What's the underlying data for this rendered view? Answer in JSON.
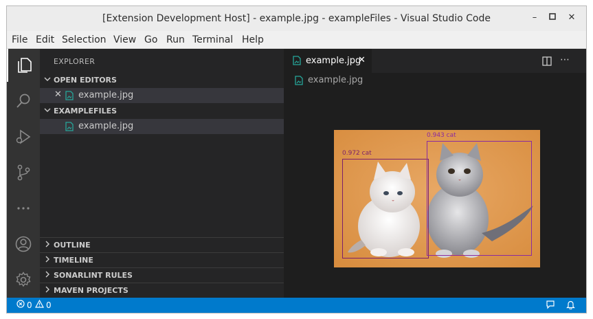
{
  "window": {
    "title": "[Extension Development Host] - example.jpg - exampleFiles - Visual Studio Code"
  },
  "menu": [
    "File",
    "Edit",
    "Selection",
    "View",
    "Go",
    "Run",
    "Terminal",
    "Help"
  ],
  "sidebar": {
    "title": "EXPLORER",
    "open_editors": {
      "label": "OPEN EDITORS",
      "files": [
        "example.jpg"
      ]
    },
    "workspace": {
      "label": "EXAMPLEFILES",
      "files": [
        "example.jpg"
      ]
    },
    "collapsed_sections": [
      "OUTLINE",
      "TIMELINE",
      "SONARLINT RULES",
      "MAVEN PROJECTS"
    ]
  },
  "editor": {
    "tab_label": "example.jpg",
    "breadcrumb": "example.jpg",
    "detections": [
      {
        "label": "0.972 cat",
        "color": "#7a1f6b"
      },
      {
        "label": "0.943 cat",
        "color": "#8a2aa0"
      }
    ]
  },
  "status": {
    "errors": "0",
    "warnings": "0"
  },
  "colors": {
    "accent": "#007acc",
    "file_icon": "#26a69a"
  }
}
